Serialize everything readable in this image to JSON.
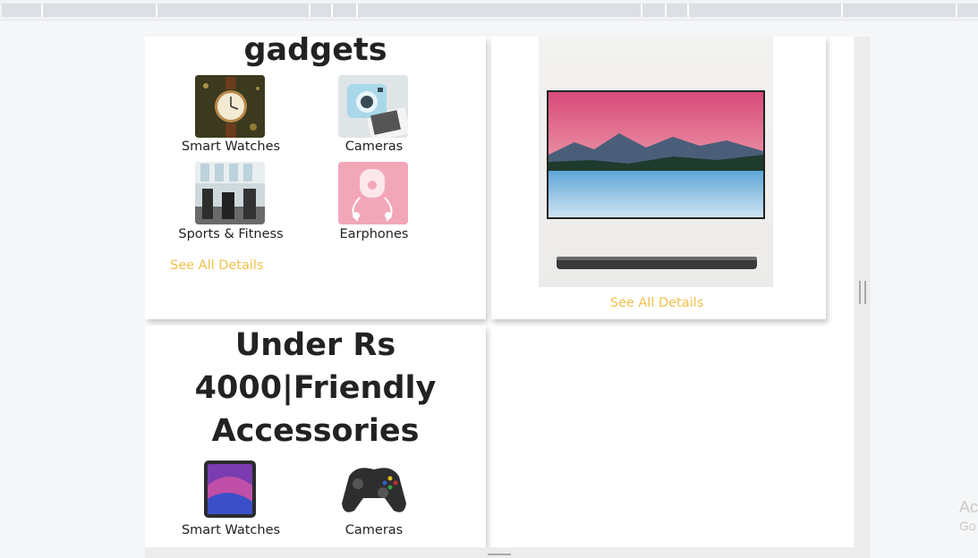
{
  "gadgets_card": {
    "heading": "gadgets",
    "items": [
      {
        "label": "Smart Watches"
      },
      {
        "label": "Cameras"
      },
      {
        "label": "Sports & Fitness"
      },
      {
        "label": "Earphones"
      }
    ],
    "link": "See All Details"
  },
  "tv_card": {
    "link": "See All Details"
  },
  "accessories_card": {
    "heading_line1": "Under Rs",
    "heading_line2": "4000|Friendly",
    "heading_line3": "Accessories",
    "items": [
      {
        "label": "Smart Watches"
      },
      {
        "label": "Cameras"
      }
    ]
  },
  "overlay": {
    "line1": "Ac",
    "line2": "Go"
  },
  "colors": {
    "link": "#f0c14b",
    "text": "#222222",
    "card_bg": "#ffffff"
  }
}
